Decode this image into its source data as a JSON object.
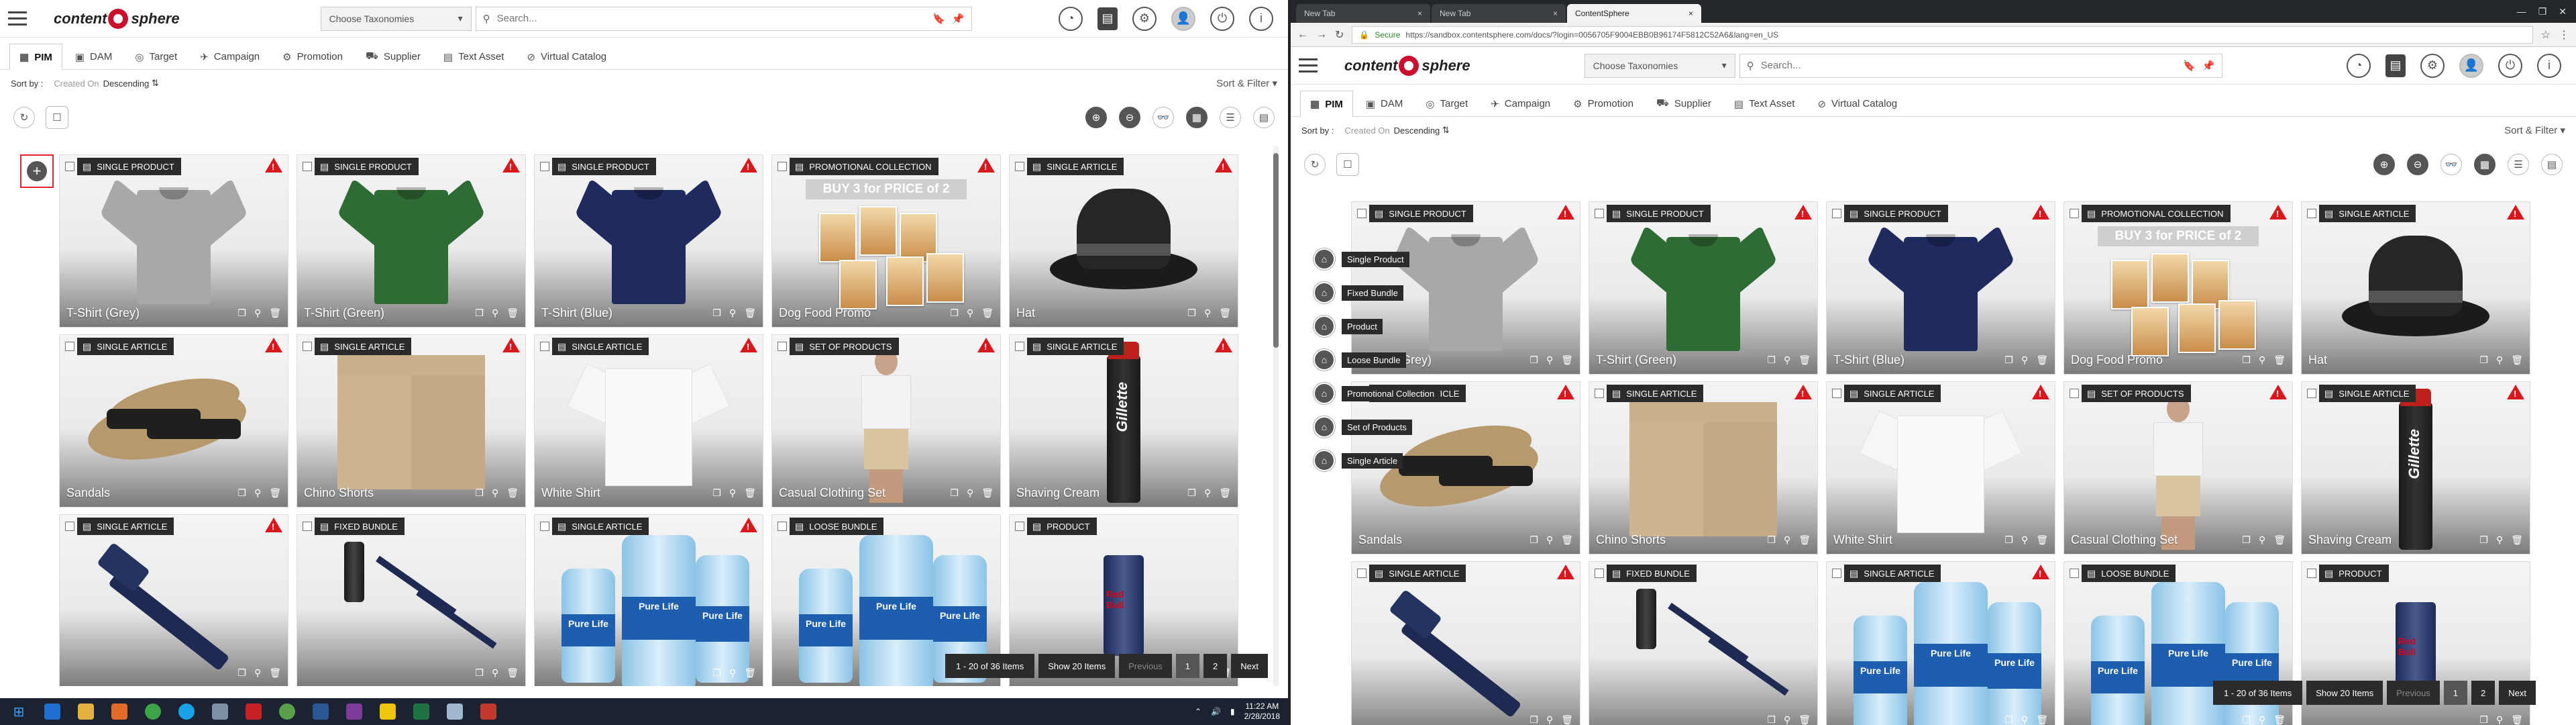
{
  "app": {
    "logo_left": "content",
    "logo_right": "sphere",
    "taxonomy_select": "Choose Taxonomies",
    "search_placeholder": "Search...",
    "tabs": [
      {
        "label": "PIM",
        "icon": "▦"
      },
      {
        "label": "DAM",
        "icon": "▣"
      },
      {
        "label": "Target",
        "icon": "◎"
      },
      {
        "label": "Campaign",
        "icon": "✈"
      },
      {
        "label": "Promotion",
        "icon": "⚙"
      },
      {
        "label": "Supplier",
        "icon": "⛟"
      },
      {
        "label": "Text Asset",
        "icon": "▤"
      },
      {
        "label": "Virtual Catalog",
        "icon": "⊘"
      }
    ],
    "sort": {
      "label": "Sort by :",
      "field": "Created On",
      "direction": "Descending",
      "sort_filter": "Sort & Filter"
    },
    "cards": [
      {
        "type": "Single Product",
        "name": "T-Shirt (Grey)",
        "art": "tee",
        "color": "#a8a8a8"
      },
      {
        "type": "Single Product",
        "name": "T-Shirt (Green)",
        "art": "tee",
        "color": "#2f6b35"
      },
      {
        "type": "Single Product",
        "name": "T-Shirt (Blue)",
        "art": "tee",
        "color": "#1f2a5e"
      },
      {
        "type": "Promotional Collection",
        "name": "Dog Food Promo",
        "art": "promo",
        "banner": "BUY 3 for PRICE of 2"
      },
      {
        "type": "Single Article",
        "name": "Hat",
        "art": "hat"
      },
      {
        "type": "Single Article",
        "name": "Sandals",
        "art": "sandal"
      },
      {
        "type": "Single Article",
        "name": "Chino Shorts",
        "art": "shorts"
      },
      {
        "type": "Single Article",
        "name": "White Shirt",
        "art": "whiteshirt"
      },
      {
        "type": "Set of Products",
        "name": "Casual Clothing Set",
        "art": "person"
      },
      {
        "type": "Single Article",
        "name": "Shaving Cream",
        "art": "gillette",
        "brand": "Gillette"
      },
      {
        "type": "Single Article",
        "name": "",
        "art": "razor"
      },
      {
        "type": "Fixed Bundle",
        "name": "",
        "art": "razorbundle"
      },
      {
        "type": "Single Article",
        "name": "",
        "art": "water",
        "brand": "Pure Life"
      },
      {
        "type": "Loose Bundle",
        "name": "",
        "art": "water",
        "brand": "Pure Life"
      },
      {
        "type": "Product",
        "name": "",
        "art": "redbull",
        "brand": "Red Bull"
      }
    ],
    "pager": {
      "info": "1 - 20 of 36 Items",
      "show": "Show 20 Items",
      "prev": "Previous",
      "pages": [
        "1",
        "2"
      ],
      "next": "Next"
    }
  },
  "browser": {
    "tabs": [
      {
        "label": "New Tab"
      },
      {
        "label": "New Tab"
      },
      {
        "label": "ContentSphere"
      }
    ],
    "secure": "Secure",
    "url": "https://sandbox.contentsphere.com/docs/?login=0056705F9004EBB0B96174F5812C52A6&lang=en_US"
  },
  "taxonomy_menu": [
    "Single Product",
    "Fixed Bundle",
    "Product",
    "Loose Bundle",
    "Promotional Collection",
    "Set of Products",
    "Single Article"
  ],
  "taskbar": {
    "time": "11:22 AM",
    "date": "2/28/2018"
  },
  "colors": {
    "accent": "#c8102e",
    "warning": "#d7191f",
    "dark": "#2b2b2b"
  }
}
